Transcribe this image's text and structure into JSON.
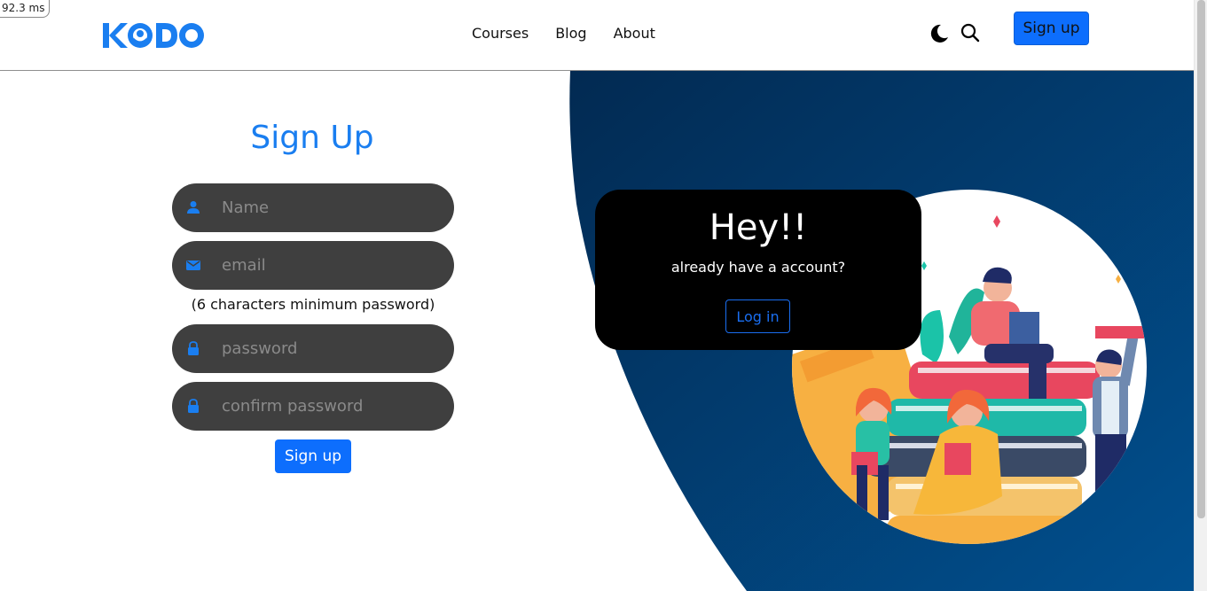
{
  "perf_overlay": "92.3 ms",
  "brand": {
    "name": "KODO",
    "color": "#1a7ef0"
  },
  "nav": {
    "items": [
      "Courses",
      "Blog",
      "About"
    ]
  },
  "header": {
    "signup_label": "Sign up",
    "theme_icon": "moon-icon",
    "search_icon": "search-icon"
  },
  "form": {
    "title": "Sign Up",
    "name_placeholder": "Name",
    "email_placeholder": "email",
    "hint": "(6 characters minimum password)",
    "password_placeholder": "password",
    "confirm_placeholder": "confirm password",
    "submit_label": "Sign up"
  },
  "card": {
    "heading": "Hey!!",
    "text": "already have a account?",
    "login_label": "Log in"
  },
  "colors": {
    "accent": "#0d6efd",
    "field_bg": "#3f3f3f",
    "panel_bg": "#003a70",
    "card_bg": "#000000"
  }
}
